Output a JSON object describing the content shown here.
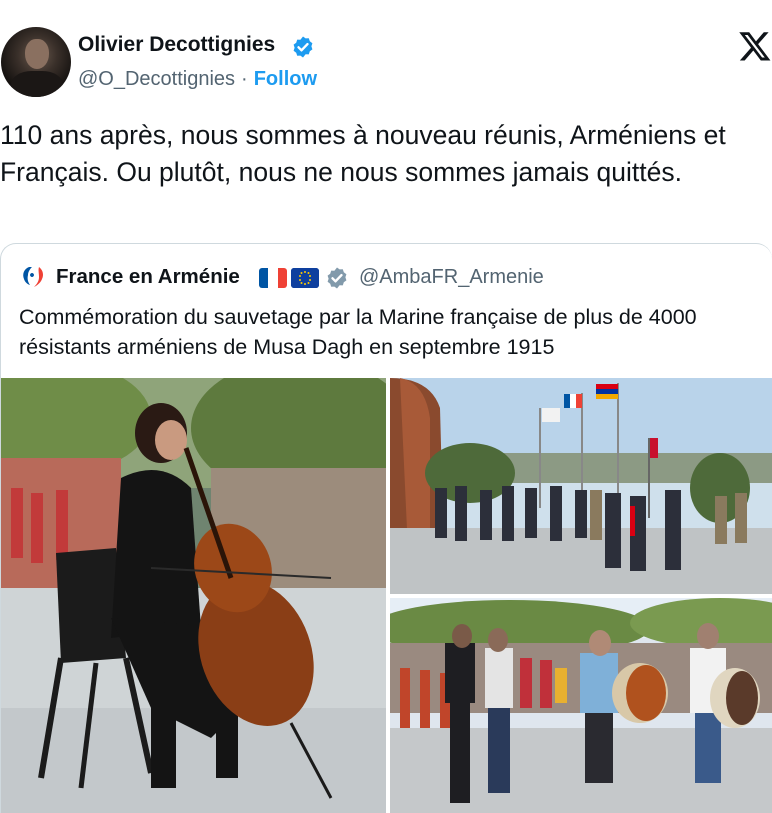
{
  "tweet": {
    "author_name": "Olivier Decottignies",
    "handle": "@O_Decottignies",
    "separator": "·",
    "follow_label": "Follow",
    "text": "110 ans après, nous sommes à nouveau réunis, Arméniens et Français. Ou plutôt, nous ne nous sommes jamais quittés."
  },
  "quote": {
    "author_name": "France en Arménie",
    "handle": "@AmbaFR_Armenie",
    "text": "Commémoration du sauvetage par la Marine française de plus de 4000 résistants arméniens de Musa Dagh en septembre 1915"
  },
  "photos": [
    {
      "subject": "cellist performing outdoors"
    },
    {
      "subject": "official ceremony with flags"
    },
    {
      "subject": "traditional drummers and dancers"
    }
  ],
  "icons": {
    "verified": "verified-badge-icon",
    "platform": "x-logo-icon",
    "quote_avatar": "france-marianne-logo-icon",
    "flags": [
      "france-flag-icon",
      "eu-flag-icon"
    ]
  },
  "colors": {
    "accent": "#1d9bf0",
    "verified": "#1d9bf0",
    "text": "#0f1419",
    "secondary": "#536471",
    "border": "#cfd9de",
    "france_blue": "#0055a4",
    "france_red": "#ef4135"
  }
}
